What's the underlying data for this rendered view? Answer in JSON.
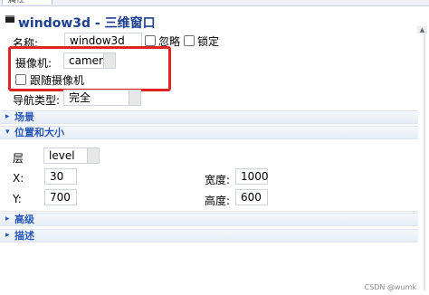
{
  "panel": {
    "tab_label": "属性",
    "title": "window3d - 三维窗口"
  },
  "fields": {
    "name_label": "名称:",
    "name_value": "window3d",
    "ignore_label": "忽略",
    "lock_label": "锁定",
    "camera_label": "摄像机:",
    "camera_value": "camera",
    "follow_camera_label": "跟随摄像机",
    "nav_type_label": "导航类型:",
    "nav_type_value": "完全"
  },
  "sections": {
    "scene": "场景",
    "position_size": "位置和大小",
    "advanced": "高级",
    "description": "描述"
  },
  "position": {
    "layer_label": "层",
    "layer_value": "level",
    "x_label": "X:",
    "x_value": "30",
    "y_label": "Y:",
    "y_value": "700",
    "width_label": "宽度:",
    "width_value": "1000",
    "height_label": "高度:",
    "height_value": "600"
  },
  "icons": {
    "expand": "▸",
    "collapse": "▾"
  },
  "watermark": "CSDN @wumk",
  "colors": {
    "title": "#1f3f8f",
    "section": "#2a58b8",
    "highlight": "#e02323"
  }
}
